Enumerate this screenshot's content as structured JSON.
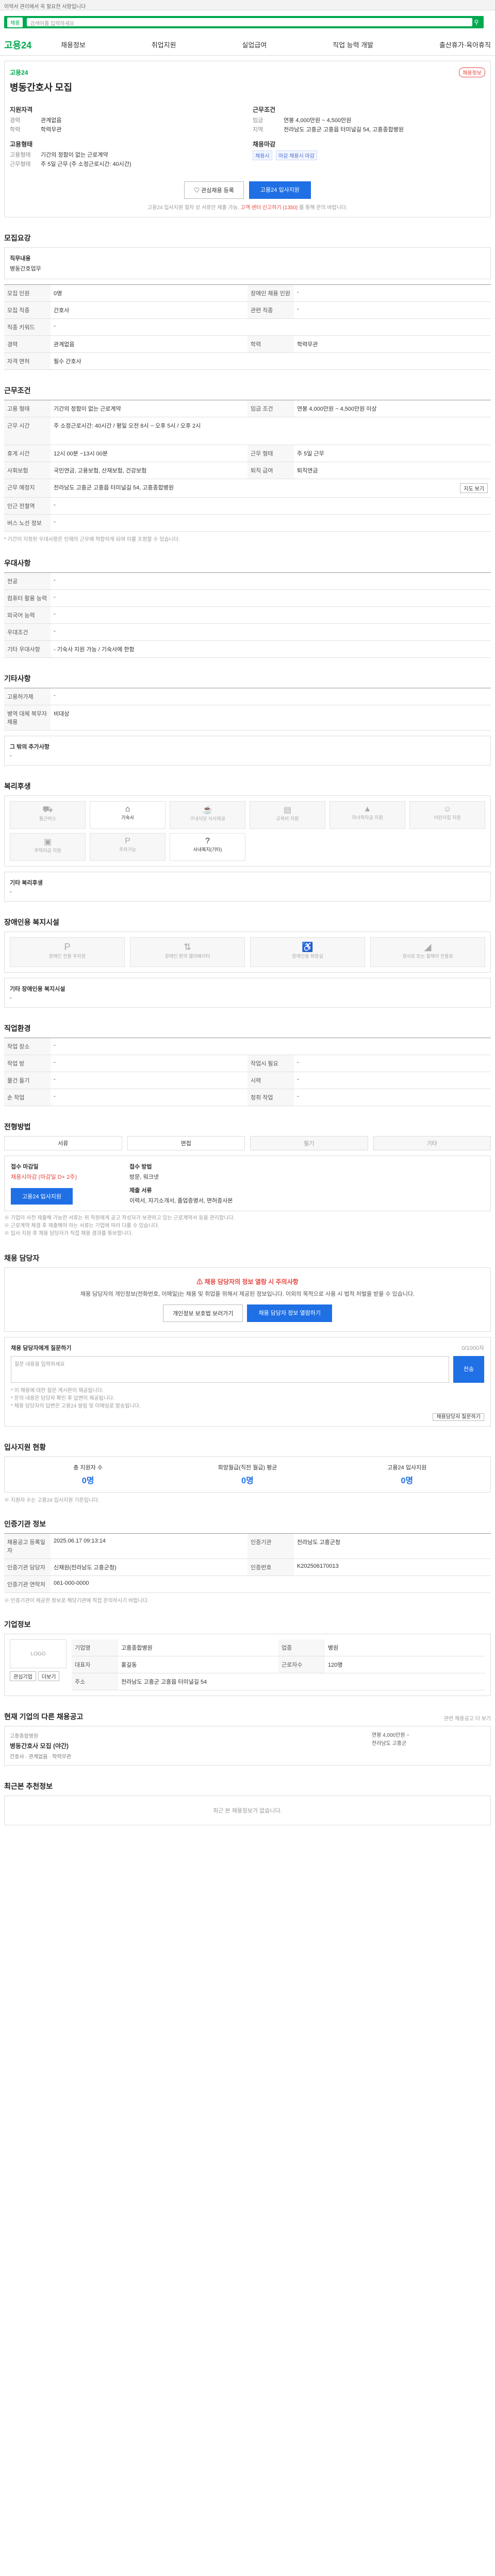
{
  "topbar": {
    "text": "이력서 관리에서 꼭 필요한 사항입니다"
  },
  "search": {
    "mode": "채용",
    "placeholder": "검색어를 입력하세요"
  },
  "gnb": {
    "logo": "고용24",
    "menu": [
      "채용정보",
      "취업지원",
      "실업급여",
      "직업 능력 개발",
      "출산휴가·육아휴직"
    ],
    "topright": "채용정보"
  },
  "job": {
    "org": "고용24",
    "title": "병동간호사 모집",
    "left_head": "지원자격",
    "left": [
      {
        "k": "경력",
        "v": "관계없음"
      },
      {
        "k": "학력",
        "v": "학력무관"
      }
    ],
    "left_head2": "고용형태",
    "left2": [
      {
        "k": "고용형태",
        "v": "기간의 정함이 없는 근로계약"
      },
      {
        "k": "근무형태",
        "v": "주 5일 근무 (주 소정근로시간: 40시간)"
      }
    ],
    "right_head": "근무조건",
    "right": [
      {
        "k": "임금",
        "v": "연봉 4,000만원 ~ 4,500만원"
      },
      {
        "k": "지역",
        "v": "전라남도 고흥군 고흥읍 터미널길 54, 고흥종합병원"
      }
    ],
    "right_head2": "채용마감",
    "deadline_tags": [
      "채용시",
      "마감 채용시 마감"
    ],
    "btn_interest": "관심채용 등록",
    "btn_apply": "고용24 입사지원",
    "note": "고용24 입사지원 절차 상 서류만 제출 가능, ",
    "note_red": "고객 센터 신고하기 (1350)",
    "note_tail": " 를 통해 문의 바랍니다."
  },
  "recruit": {
    "head": "모집요강",
    "duty_title": "직무내용",
    "duty": "병동간호업무",
    "rows": [
      {
        "k": "모집 인원",
        "v": "0명",
        "k2": "장애인 채용 인원",
        "v2": "-"
      },
      {
        "k": "모집 직종",
        "v": "간호사",
        "k2": "관련 직종",
        "v2": "-"
      },
      {
        "k": "직종 키워드",
        "v": "-",
        "k2": "",
        "v2": ""
      },
      {
        "k": "경력",
        "v": "관계없음",
        "k2": "학력",
        "v2": "학력무관"
      },
      {
        "k": "자격 면허",
        "v": "필수 간호사",
        "k2": "",
        "v2": ""
      }
    ]
  },
  "workcond": {
    "head": "근무조건",
    "rows": [
      {
        "k": "고용 형태",
        "v": "기간의 정함이 없는 근로계약",
        "k2": "임금 조건",
        "v2": "연봉 4,000만원 ~ 4,500만원 이상"
      },
      {
        "k": "근무 시간",
        "v": "주 소정근로시간: 40시간 / 평일 오전 8시 ~ 오후 5시 / 오후 2시",
        "k2": "",
        "v2": ""
      },
      {
        "k": "휴게 시간",
        "v": "12시 00분 ~13시 00분",
        "k2": "근무 형태",
        "v2": "주 5일 근무"
      },
      {
        "k": "사회보험",
        "v": "국민연금, 고용보험, 산재보험, 건강보험",
        "k2": "퇴직 급여",
        "v2": "퇴직연금"
      },
      {
        "k": "근무 예정지",
        "v": "전라남도 고흥군 고흥읍 터미널길 54, 고흥종합병원",
        "k2": "",
        "v2": ""
      },
      {
        "k": "인근 전철역",
        "v": "-",
        "k2": "",
        "v2": ""
      },
      {
        "k": "버스 노선 정보",
        "v": "-",
        "k2": "",
        "v2": ""
      }
    ],
    "map_btn": "지도 보기",
    "note": "* 기간이 지정된 우대사항은 인재의 근무에 적합하게 되며 이를 조정할 수 있습니다."
  },
  "pref": {
    "head": "우대사항",
    "rows": [
      {
        "k": "전공",
        "v": "-"
      },
      {
        "k": "컴퓨터 활용 능력",
        "v": "-"
      },
      {
        "k": "외국어 능력",
        "v": "-"
      },
      {
        "k": "우대조건",
        "v": "-"
      },
      {
        "k": "기타 우대사항",
        "v": "- 기숙사 지원 가능 / 기숙사에 한함"
      }
    ]
  },
  "etc": {
    "head": "기타사항",
    "rows": [
      {
        "k": "고용허가제",
        "v": "-"
      },
      {
        "k": "병역 대체 복무자 채용",
        "v": "비대상"
      }
    ],
    "other_title": "그 밖의 추가사항",
    "other": "-"
  },
  "welfare": {
    "head": "복리후생",
    "items": [
      {
        "icon": "car-icon",
        "label": "통근버스"
      },
      {
        "icon": "home-icon",
        "label": "기숙사"
      },
      {
        "icon": "food-icon",
        "label": "구내식당 식사제공"
      },
      {
        "icon": "book-icon",
        "label": "교육비 지원"
      },
      {
        "icon": "cap-icon",
        "label": "자녀학자금 지원"
      },
      {
        "icon": "child-icon",
        "label": "어린이집 지원"
      },
      {
        "icon": "bed-icon",
        "label": "주택자금 지원"
      },
      {
        "icon": "parking-icon",
        "label": "주차가능"
      },
      {
        "icon": "help-icon",
        "label": "사내복지(기타)"
      }
    ],
    "other_title": "기타 복리후생",
    "other": "-"
  },
  "disabled": {
    "head": "장애인용 복지시설",
    "items": [
      {
        "icon": "parking-icon",
        "label": "장애인 전용 주차장"
      },
      {
        "icon": "elevator-icon",
        "label": "장애인 편의 엘리베이터"
      },
      {
        "icon": "toilet-icon",
        "label": "장애인용 화장실"
      },
      {
        "icon": "ramp-icon",
        "label": "경사로 또는 휠체어 전용로"
      }
    ],
    "other_title": "기타 장애인용 복지시설",
    "other": "-"
  },
  "env": {
    "head": "직업환경",
    "rows": [
      {
        "k": "작업 장소",
        "v": "-",
        "k2": "",
        "v2": ""
      },
      {
        "k": "작업 방",
        "v": "-",
        "k2": "작업시 필요",
        "v2": "-"
      },
      {
        "k": "물건 들기",
        "v": "-",
        "k2": "시력",
        "v2": "-"
      },
      {
        "k": "손 작업",
        "v": "-",
        "k2": "청취 작업",
        "v2": "-"
      }
    ]
  },
  "method": {
    "head": "전형방법",
    "items": [
      "서류",
      "면접",
      "필기",
      "기타"
    ],
    "apply_k": "접수 마감일",
    "apply_v": "채용시마감 (마감일 D+ 2주)",
    "apply_btn": "고용24 입사지원",
    "doc_k": "접수 방법",
    "doc_v": "방문, 워크넷",
    "doc_k2": "제출 서류",
    "doc_v2": "이력서, 자기소개서, 졸업증명서, 면허증사본",
    "notes": [
      "※ 기업이 사전 제출해 가능한 서류는 위 직원에게 공고 작성자가 보관하고 있는 근로계약서 등을 관리합니다.",
      "※ 근로계약 체결 후 제출해야 하는 서류는 기업에 따라 다를 수 있습니다.",
      "※ 입사 지원 후 채용 담당자가 직접 채용 결과를 통보합니다."
    ]
  },
  "manager": {
    "head": "채용 담당자",
    "warn": "채용 담당자의 정보 열람 시 주의사항",
    "desc": "채용 담당자의 개인정보(전화번호, 이메일)는 채용 및 취업을 위해서 제공된 정보입니다. 이외의 목적으로 사용 시 법적 처벌을 받을 수 있습니다.",
    "btn_priv": "개인정보 보호법 보러가기",
    "btn_view": "채용 담당자 정보 열람하기",
    "q_title": "채용 담당자에게 질문하기",
    "q_count": "0/1000자",
    "q_placeholder": "질문 내용을 입력하세요",
    "q_send": "전송",
    "q_notes": [
      "* 이 채용에 대한 질문 게시판이 제공됩니다.",
      "* 문의 내용은 담당자 확인 후 답변이 제공됩니다.",
      "* 채용 담당자의 답변은 고용24 알림 및 이메일로 발송됩니다."
    ],
    "q_btn": "채용담당자 질문하기"
  },
  "stats": {
    "head": "입사지원 현황",
    "items": [
      {
        "label": "총 지원자 수",
        "value": "0명"
      },
      {
        "label": "희망월급(직전 월급) 평균",
        "value": "0명"
      },
      {
        "label": "고용24 입사지원",
        "value": "0명"
      }
    ],
    "note": "※ 지원자 수는 고용24 입사지원 기준입니다."
  },
  "info": {
    "head": "인증기관 정보",
    "rows": [
      {
        "k": "채용공고 등록일자",
        "v": "2025.06.17 09:13:14",
        "k2": "인증기관",
        "v2": "전라남도 고흥군청"
      },
      {
        "k": "인증기관 담당자",
        "v": "신채원(전라남도 고흥군청)",
        "k2": "인증번호",
        "v2": "K202506170013"
      },
      {
        "k": "인증기관 연락처",
        "v": "061-000-0000",
        "k2": "",
        "v2": ""
      }
    ],
    "note": "※ 인증기관이 제공한 정보로 해당기관에 직접 문의하시기 바랍니다."
  },
  "company": {
    "head": "기업정보",
    "logo": "LOGO",
    "btn_follow": "관심기업",
    "btn_more": "더보기",
    "rows": [
      {
        "k": "기업명",
        "v": "고흥종합병원",
        "k2": "업종",
        "v2": "병원"
      },
      {
        "k": "대표자",
        "v": "홍길동",
        "k2": "근로자수",
        "v2": "120명"
      },
      {
        "k": "주소",
        "v": "전라남도 고흥군 고흥읍 터미널길 54",
        "k2": "",
        "v2": ""
      }
    ]
  },
  "similar": {
    "head": "현재 기업의 다른 채용공고",
    "link": "관련 채용공고 더 보기",
    "org": "고흥종합병원",
    "title": "병동간호사 모집 (야간)",
    "meta": "간호사 · 관계없음 · 학력무관",
    "pay": "연봉 4,000만원 ~",
    "loc": "전라남도 고흥군"
  },
  "recent": {
    "head": "최근본 추천정보",
    "empty": "최근 본 채용정보가 없습니다."
  }
}
